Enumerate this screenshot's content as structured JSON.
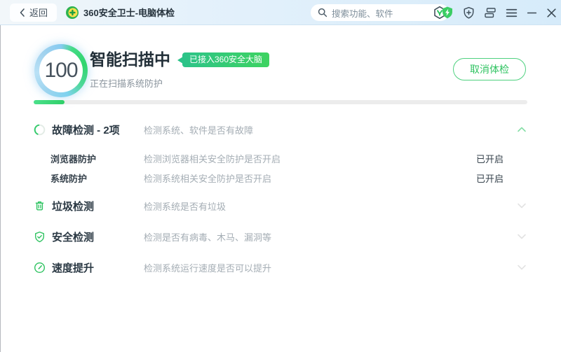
{
  "titlebar": {
    "back_label": "返回",
    "app_title": "360安全卫士-电脑体检",
    "search_placeholder": "搜索功能、软件",
    "icon_names": [
      "search-icon",
      "safety-brain-icon",
      "protection-shield-icon",
      "add-protection-icon",
      "window-mode-icon",
      "main-menu-icon",
      "minimize-icon",
      "close-icon"
    ]
  },
  "hero": {
    "score": "100",
    "title": "智能扫描中",
    "badge": "已接入360安全大脑",
    "status": "正在扫描系统防护",
    "cancel_label": "取消体检",
    "progress_percent": 6.3
  },
  "scan_items": [
    {
      "label": "故障检测 - 2项",
      "desc": "检测系统、软件是否有故障",
      "icon": "spinner-icon",
      "expanded": true,
      "children": [
        {
          "label": "浏览器防护",
          "desc": "检测浏览器相关安全防护是否开启",
          "status": "已开启"
        },
        {
          "label": "系统防护",
          "desc": "检测系统相关安全防护是否开启",
          "status": "已开启"
        }
      ]
    },
    {
      "label": "垃圾检测",
      "desc": "检测系统是否有垃圾",
      "icon": "trash-icon",
      "expanded": false
    },
    {
      "label": "安全检测",
      "desc": "检测是否有病毒、木马、漏洞等",
      "icon": "shield-check-icon",
      "expanded": false
    },
    {
      "label": "速度提升",
      "desc": "检测系统运行速度是否可以提升",
      "icon": "gauge-icon",
      "expanded": false
    }
  ],
  "colors": {
    "accent_green": "#2fc361",
    "badge_gradient_start": "#2cc389",
    "badge_gradient_end": "#3ed361",
    "titlebar_blue": "#d9ecfb",
    "progress_track": "#ececec",
    "ring_blue": "#8ccdf1",
    "ring_green": "#2fd56e",
    "text_dark": "#2b3944",
    "text_gray": "#a4adb4"
  }
}
